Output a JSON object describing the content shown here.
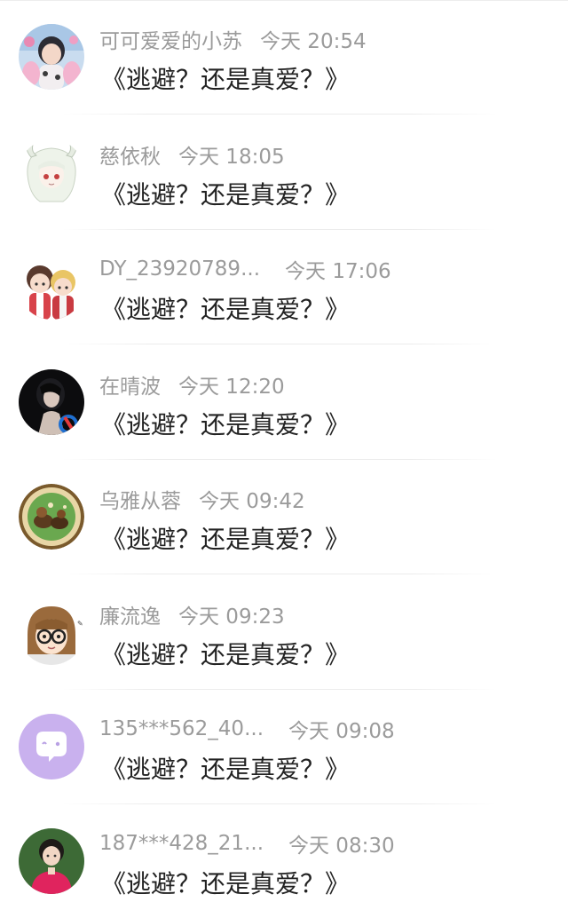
{
  "messages": [
    {
      "username": "可可爱爱的小苏",
      "time": "今天 20:54",
      "text": "《逃避？还是真爱？》",
      "avatar": "avatar-girl-pink"
    },
    {
      "username": "慈依秋",
      "time": "今天 18:05",
      "text": "《逃避？还是真爱？》",
      "avatar": "avatar-anime-white-hair"
    },
    {
      "username": "DY_23920789...",
      "time": "今天 17:06",
      "text": "《逃避？还是真爱？》",
      "avatar": "avatar-anime-two-boys"
    },
    {
      "username": "在晴波",
      "time": "今天 12:20",
      "text": "《逃避？还是真爱？》",
      "avatar": "avatar-dark-woman"
    },
    {
      "username": "乌雅从蓉",
      "time": "今天 09:42",
      "text": "《逃避？还是真爱？》",
      "avatar": "avatar-cartoon-animals"
    },
    {
      "username": "廉流逸",
      "time": "今天 09:23",
      "text": "《逃避？还是真爱？》",
      "avatar": "avatar-glasses-girl"
    },
    {
      "username": "135***562_40...",
      "time": "今天 09:08",
      "text": "《逃避？还是真爱？》",
      "avatar": "avatar-purple-chat-bubble"
    },
    {
      "username": "187***428_21...",
      "time": "今天 08:30",
      "text": "《逃避？还是真爱？》",
      "avatar": "avatar-red-shirt-boy"
    }
  ],
  "colors": {
    "username": "#9b9b9b",
    "message": "#222222",
    "background": "#ffffff",
    "divider": "#ececec"
  }
}
